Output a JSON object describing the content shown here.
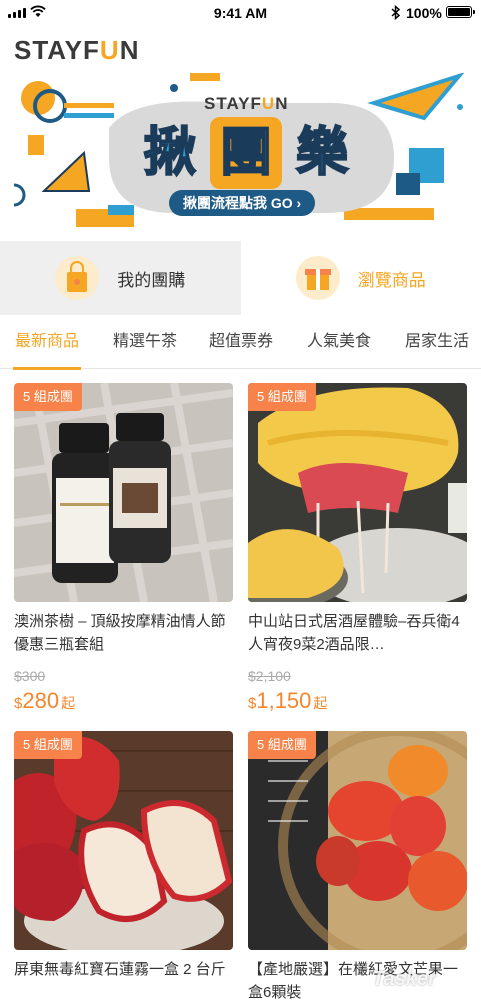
{
  "status_bar": {
    "time": "9:41 AM",
    "battery": "100%",
    "battery_level": 1.0
  },
  "header": {
    "logo_main": "STAYF",
    "logo_accent": "U",
    "logo_end": "N"
  },
  "banner": {
    "brand_main": "STAYF",
    "brand_accent": "U",
    "brand_end": "N",
    "title_chars": [
      "揪",
      "團",
      "樂"
    ],
    "cta": "揪團流程點我 GO ›",
    "colors": {
      "orange": "#f5a623",
      "blue": "#2e9fd0",
      "navy": "#1b3b5a",
      "cta_bg": "#1e5a86"
    }
  },
  "quick_entries": [
    {
      "label": "我的團購",
      "icon": "shopping-bag-icon"
    },
    {
      "label": "瀏覽商品",
      "icon": "gift-box-icon"
    }
  ],
  "tabs": [
    "最新商品",
    "精選午茶",
    "超值票券",
    "人氣美食",
    "居家生活"
  ],
  "active_tab": 0,
  "products": [
    {
      "badge": "5 組成團",
      "title": "澳洲茶樹 – 頂級按摩精油情人節優惠三瓶套組",
      "old_price": "$300",
      "currency": "$",
      "price": "280",
      "suffix": "起",
      "image": "essential-oil-bottles"
    },
    {
      "badge": "5 組成團",
      "title": "中山站日式居酒屋體驗–吞兵衛4人宵夜9菜2酒品限…",
      "old_price": "$2,100",
      "currency": "$",
      "price": "1,150",
      "suffix": "起",
      "image": "omelette-roll"
    },
    {
      "badge": "5 組成團",
      "title": "屏東無毒紅寶石蓮霧一盒 2 台斤",
      "old_price": "",
      "currency": "",
      "price": "",
      "suffix": "",
      "image": "wax-apples"
    },
    {
      "badge": "5 組成團",
      "title": "【產地嚴選】在欉紅愛文芒果一盒6顆裝",
      "old_price": "",
      "currency": "",
      "price": "",
      "suffix": "",
      "image": "mangoes-basket"
    }
  ],
  "watermark": "Tasker",
  "accent_color": "#f5a623",
  "badge_color": "#f7834a",
  "price_color": "#f5862c"
}
